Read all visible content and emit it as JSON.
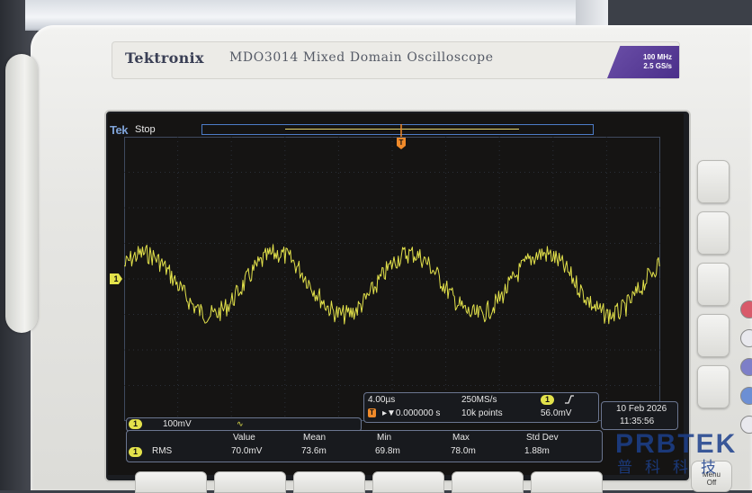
{
  "brand": {
    "logo": "Tektronix",
    "model": "MDO3014 Mixed Domain Oscilloscope",
    "bandwidth": "100 MHz",
    "sample_rate": "2.5 GS/s"
  },
  "screen": {
    "logo": "Tek",
    "acq_state": "Stop",
    "channel1": {
      "marker": "1",
      "scale": "100mV",
      "bw_icon": "∿",
      "color": "#e3e24b"
    },
    "horizontal": {
      "time_per_div": "4.00µs",
      "trigger_marker": "T",
      "trigger_delay": "▸▼0.000000 s",
      "sample_rate": "250MS/s",
      "record_length": "10k points",
      "trigger_source": "1",
      "trigger_slope_icon": "rising-edge-icon",
      "trigger_level": "56.0mV",
      "trigger_color": "#f08a2a"
    },
    "datetime": {
      "date": "10 Feb 2026",
      "time": "11:35:56"
    },
    "measurements": {
      "headers": [
        "Value",
        "Mean",
        "Min",
        "Max",
        "Std Dev"
      ],
      "rows": [
        {
          "channel": "1",
          "type": "RMS",
          "values": [
            "70.0mV",
            "73.6m",
            "69.8m",
            "78.0m",
            "1.88m"
          ]
        }
      ]
    }
  },
  "front_panel": {
    "menu_off_label_1": "Menu",
    "menu_off_label_2": "Off"
  },
  "watermark": {
    "text_en": "PRBTEK",
    "text_cn": "普科科技"
  }
}
